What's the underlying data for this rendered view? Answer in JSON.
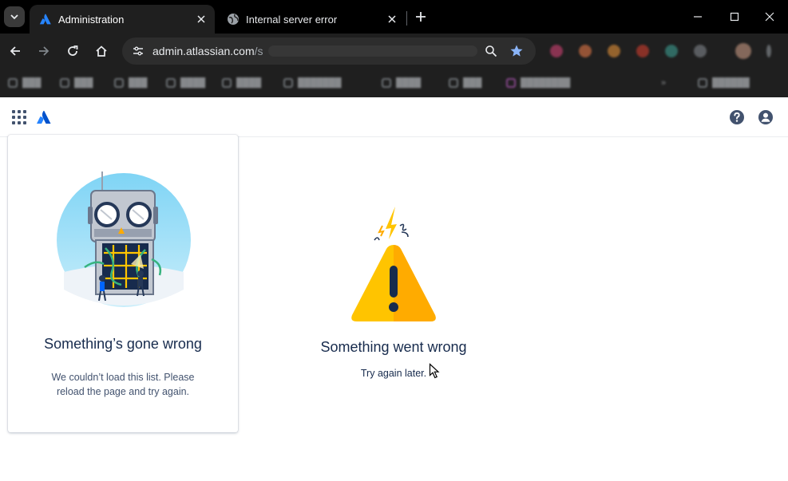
{
  "browser": {
    "tabs": [
      {
        "title": "Administration",
        "icon": "atlassian-icon",
        "active": true
      },
      {
        "title": "Internal server error",
        "icon": "globe-icon",
        "active": false
      }
    ],
    "omnibox": {
      "url_host": "admin.atlassian.com",
      "url_rest": "/s"
    },
    "accent_color": "#8ab4f8"
  },
  "app": {
    "brand_color": "#0052cc",
    "icons": {
      "switcher": "app-switcher-icon",
      "logo": "atlassian-logo",
      "help": "help-icon",
      "profile": "profile-icon"
    }
  },
  "list_error": {
    "title": "Something’s gone wrong",
    "message": "We couldn’t load this list. Please reload the page and try again."
  },
  "page_error": {
    "title": "Something went wrong",
    "message": "Try again later."
  },
  "colors": {
    "warning_yellow": "#ffc400",
    "text_primary": "#172b4d",
    "text_secondary": "#42526e"
  }
}
